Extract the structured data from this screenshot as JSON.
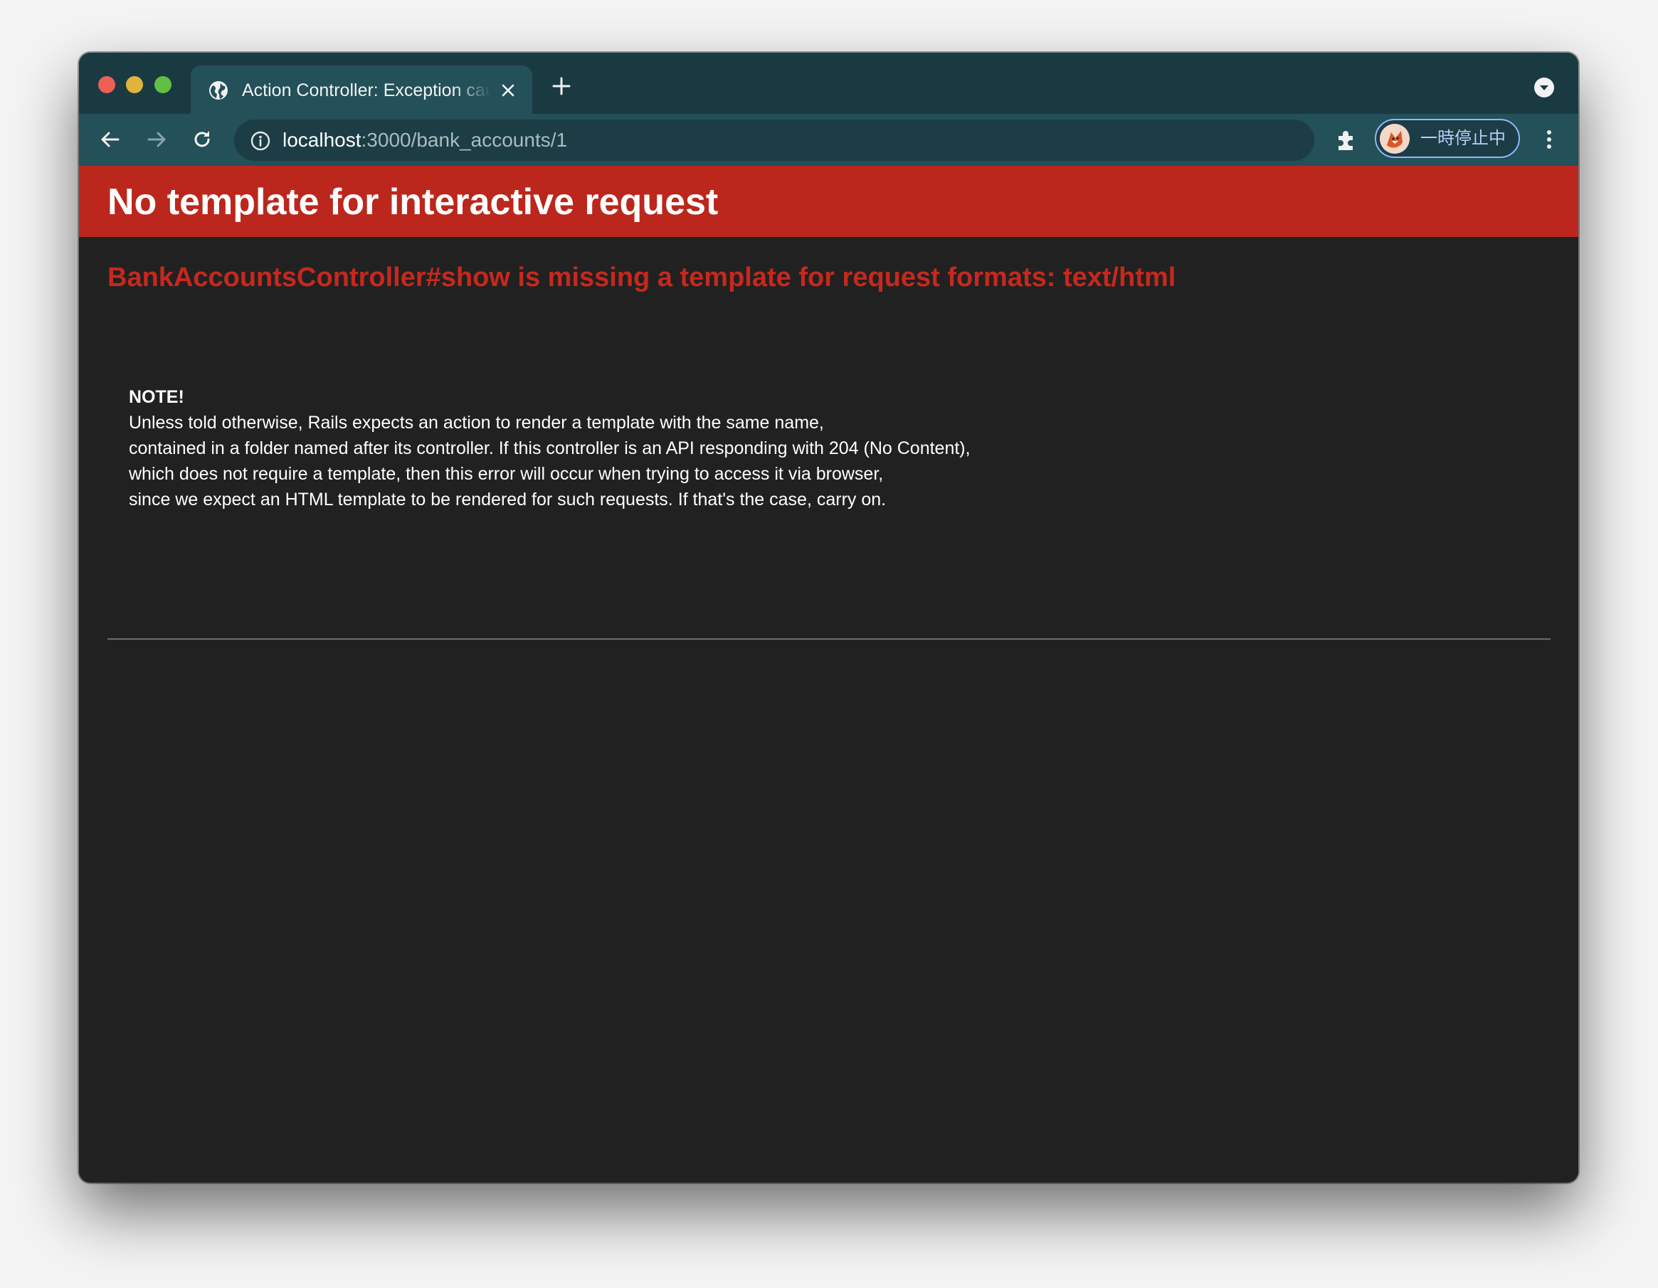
{
  "browser": {
    "tab": {
      "title": "Action Controller: Exception caught"
    },
    "address": {
      "host": "localhost",
      "path": ":3000/bank_accounts/1"
    },
    "profile": {
      "label": "一時停止中"
    }
  },
  "page": {
    "banner_title": "No template for interactive request",
    "error_heading": "BankAccountsController#show is missing a template for request formats: text/html",
    "note_title": "NOTE!",
    "note_lines": [
      "Unless told otherwise, Rails expects an action to render a template with the same name,",
      "contained in a folder named after its controller. If this controller is an API responding with 204 (No Content),",
      "which does not require a template, then this error will occur when trying to access it via browser,",
      "since we expect an HTML template to be rendered for such requests. If that's the case, carry on."
    ]
  },
  "colors": {
    "tabstrip": "#1a3a42",
    "toolbar": "#235059",
    "banner": "#bb271d",
    "error_heading": "#c7281d",
    "page_background": "#212121"
  }
}
